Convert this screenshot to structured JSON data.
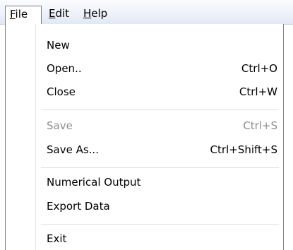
{
  "menubar": {
    "file_prefix": "F",
    "file_rest": "ile",
    "edit_prefix": "E",
    "edit_rest": "dit",
    "help_prefix": "H",
    "help_rest": "elp"
  },
  "file_menu": {
    "new": {
      "label": "New"
    },
    "open": {
      "label": "Open..",
      "shortcut": "Ctrl+O"
    },
    "close": {
      "label": "Close",
      "shortcut": "Ctrl+W"
    },
    "save": {
      "label": "Save",
      "shortcut": "Ctrl+S",
      "enabled": false
    },
    "save_as": {
      "label": "Save As...",
      "shortcut": "Ctrl+Shift+S"
    },
    "numerical_output": {
      "label": "Numerical Output"
    },
    "export_data": {
      "label": "Export Data"
    },
    "exit": {
      "label": "Exit"
    }
  },
  "colors": {
    "menubar_top": "#fbfcfe",
    "menubar_bottom": "#e2e8f3",
    "border": "#7e7e7e",
    "disabled_text": "#8d8d8d",
    "separator": "#e0e0e0"
  }
}
